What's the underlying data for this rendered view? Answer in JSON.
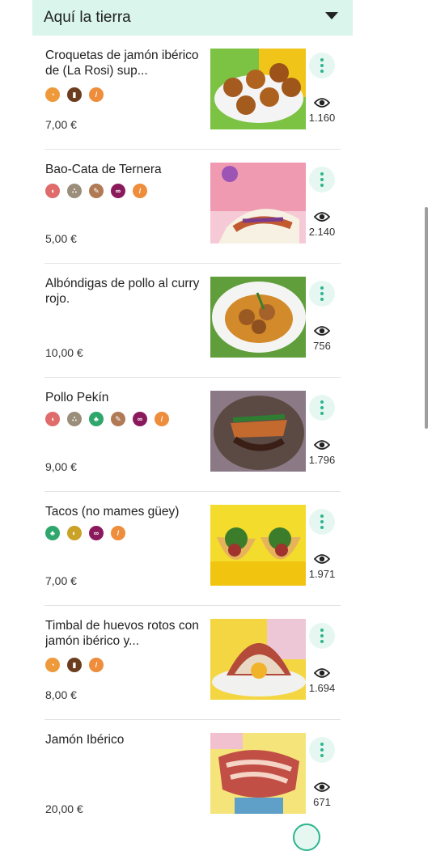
{
  "section": {
    "title": "Aquí la tierra"
  },
  "items": [
    {
      "name": "Croquetas de jamón ibérico de (La Rosi) sup...",
      "price": "7,00 €",
      "views": "1.160",
      "allergens": [
        {
          "icon": "eggs-icon",
          "color": "#ee9a3a"
        },
        {
          "icon": "milk-icon",
          "color": "#6b3d1e"
        },
        {
          "icon": "gluten-icon",
          "color": "#ee8d3b"
        }
      ]
    },
    {
      "name": "Bao-Cata de Ternera",
      "price": "5,00 €",
      "views": "2.140",
      "allergens": [
        {
          "icon": "shellfish-icon",
          "color": "#df6b6b"
        },
        {
          "icon": "peanuts-icon",
          "color": "#9a8e7a"
        },
        {
          "icon": "nuts-icon",
          "color": "#b07a55"
        },
        {
          "icon": "sulphites-icon",
          "color": "#8b1a5c"
        },
        {
          "icon": "gluten-icon",
          "color": "#ee8d3b"
        }
      ]
    },
    {
      "name": "Albóndigas de pollo al curry rojo.",
      "price": "10,00 €",
      "views": "756",
      "allergens": []
    },
    {
      "name": "Pollo Pekín",
      "price": "9,00 €",
      "views": "1.796",
      "allergens": [
        {
          "icon": "shellfish-icon",
          "color": "#df6b6b"
        },
        {
          "icon": "peanuts-icon",
          "color": "#9a8e7a"
        },
        {
          "icon": "celery-icon",
          "color": "#2fa66b"
        },
        {
          "icon": "nuts-icon",
          "color": "#b07a55"
        },
        {
          "icon": "sulphites-icon",
          "color": "#8b1a5c"
        },
        {
          "icon": "gluten-icon",
          "color": "#ee8d3b"
        }
      ]
    },
    {
      "name": "Tacos (no mames güey)",
      "price": "7,00 €",
      "views": "1.971",
      "allergens": [
        {
          "icon": "celery-icon",
          "color": "#2fa66b"
        },
        {
          "icon": "mustard-icon",
          "color": "#c9a227"
        },
        {
          "icon": "sulphites-icon",
          "color": "#8b1a5c"
        },
        {
          "icon": "gluten-icon",
          "color": "#ee8d3b"
        }
      ]
    },
    {
      "name": "Timbal de huevos rotos con jamón ibérico y...",
      "price": "8,00 €",
      "views": "1.694",
      "allergens": [
        {
          "icon": "eggs-icon",
          "color": "#ee9a3a"
        },
        {
          "icon": "milk-icon",
          "color": "#6b3d1e"
        },
        {
          "icon": "gluten-icon",
          "color": "#ee8d3b"
        }
      ]
    },
    {
      "name": "Jamón Ibérico",
      "price": "20,00 €",
      "views": "671",
      "allergens": []
    }
  ]
}
